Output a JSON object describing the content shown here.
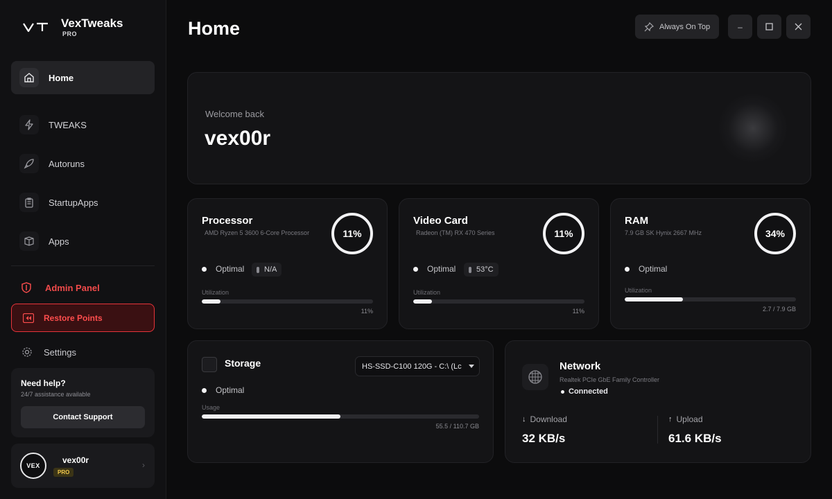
{
  "app": {
    "logo_text": "VT",
    "name": "VexTweaks",
    "tier": "PRO"
  },
  "sidebar": {
    "items": [
      {
        "label": "Home",
        "icon": "home-icon"
      },
      {
        "label": "TWEAKS",
        "icon": "bolt-icon"
      },
      {
        "label": "Autoruns",
        "icon": "rocket-icon"
      },
      {
        "label": "StartupApps",
        "icon": "clipboard-icon"
      },
      {
        "label": "Apps",
        "icon": "box-icon"
      }
    ],
    "admin_label": "Admin Panel",
    "restore_label": "Restore Points",
    "settings_label": "Settings",
    "help": {
      "title": "Need help?",
      "subtitle": "24/7 assistance available",
      "button": "Contact Support"
    },
    "user": {
      "avatar": "VEX",
      "name": "vex00r",
      "badge": "PRO"
    }
  },
  "header": {
    "title": "Home",
    "always_on_top": "Always On Top",
    "minimize": "–"
  },
  "welcome": {
    "subtitle": "Welcome back",
    "name": "vex00r"
  },
  "processor": {
    "title": "Processor",
    "model": "AMD Ryzen 5 3600 6-Core Processor",
    "percent_label": "11%",
    "status": "Optimal",
    "temp": "N/A",
    "util_label": "Utilization",
    "util_value": "11%",
    "util_fraction": 0.11
  },
  "gpu": {
    "title": "Video Card",
    "model": "Radeon (TM) RX 470 Series",
    "percent_label": "11%",
    "status": "Optimal",
    "temp": "53°C",
    "util_label": "Utilization",
    "util_value": "11%",
    "util_fraction": 0.11
  },
  "ram": {
    "title": "RAM",
    "model": "7.9 GB SK Hynix 2667 MHz",
    "percent_label": "34%",
    "status": "Optimal",
    "util_label": "Utilization",
    "util_value": "2.7  /  7.9 GB",
    "util_fraction": 0.34
  },
  "storage": {
    "title": "Storage",
    "drive": "HS-SSD-C100 120G - C:\\ (Lc",
    "status": "Optimal",
    "usage_label": "Usage",
    "usage_value": "55.5 / 110.7 GB",
    "usage_fraction": 0.5
  },
  "network": {
    "title": "Network",
    "adapter": "Realtek PCIe GbE Family Controller",
    "status": "Connected",
    "download_label": "Download",
    "download_value": "32 KB/s",
    "upload_label": "Upload",
    "upload_value": "61.6 KB/s"
  }
}
